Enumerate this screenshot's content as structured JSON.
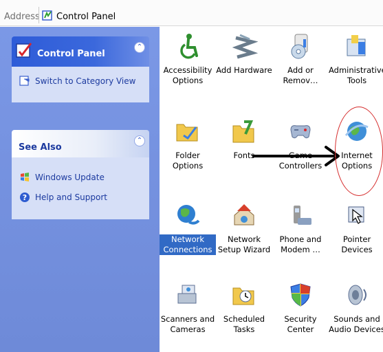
{
  "address_bar": {
    "label": "Address",
    "value": "Control Panel",
    "icon": "control-panel-icon"
  },
  "sidebar": {
    "control_panel": {
      "title": "Control Panel",
      "collapse_symbol": "⌃",
      "tasks": [
        {
          "label": "Switch to Category View",
          "icon": "switch-view-icon"
        }
      ]
    },
    "see_also": {
      "title": "See Also",
      "collapse_symbol": "⌃",
      "links": [
        {
          "label": "Windows Update",
          "icon": "windows-update-icon"
        },
        {
          "label": "Help and Support",
          "icon": "help-icon"
        }
      ]
    }
  },
  "items": [
    {
      "label": "Accessibility Options",
      "icon": "accessibility-icon",
      "selected": false
    },
    {
      "label": "Add Hardware",
      "icon": "add-hardware-icon",
      "selected": false
    },
    {
      "label": "Add or Remov…",
      "icon": "add-remove-programs-icon",
      "selected": false
    },
    {
      "label": "Administrative Tools",
      "icon": "administrative-tools-icon",
      "selected": false
    },
    {
      "label": "Folder Options",
      "icon": "folder-options-icon",
      "selected": false
    },
    {
      "label": "Fonts",
      "icon": "fonts-folder-icon",
      "selected": false
    },
    {
      "label": "Game Controllers",
      "icon": "game-controller-icon",
      "selected": false
    },
    {
      "label": "Internet Options",
      "icon": "internet-options-icon",
      "selected": false
    },
    {
      "label": "Network Connections",
      "icon": "network-connections-icon",
      "selected": true
    },
    {
      "label": "Network Setup Wizard",
      "icon": "network-setup-icon",
      "selected": false
    },
    {
      "label": "Phone and Modem …",
      "icon": "phone-modem-icon",
      "selected": false
    },
    {
      "label": "Pointer Devices",
      "icon": "pointer-devices-icon",
      "selected": false
    },
    {
      "label": "Scanners and Cameras",
      "icon": "scanner-camera-icon",
      "selected": false
    },
    {
      "label": "Scheduled Tasks",
      "icon": "scheduled-tasks-icon",
      "selected": false
    },
    {
      "label": "Security Center",
      "icon": "security-shield-icon",
      "selected": false
    },
    {
      "label": "Sounds and Audio Devices",
      "icon": "speaker-icon",
      "selected": false
    }
  ],
  "annotation": {
    "arrow_color": "#000000",
    "circle_color": "#d52b2b"
  }
}
